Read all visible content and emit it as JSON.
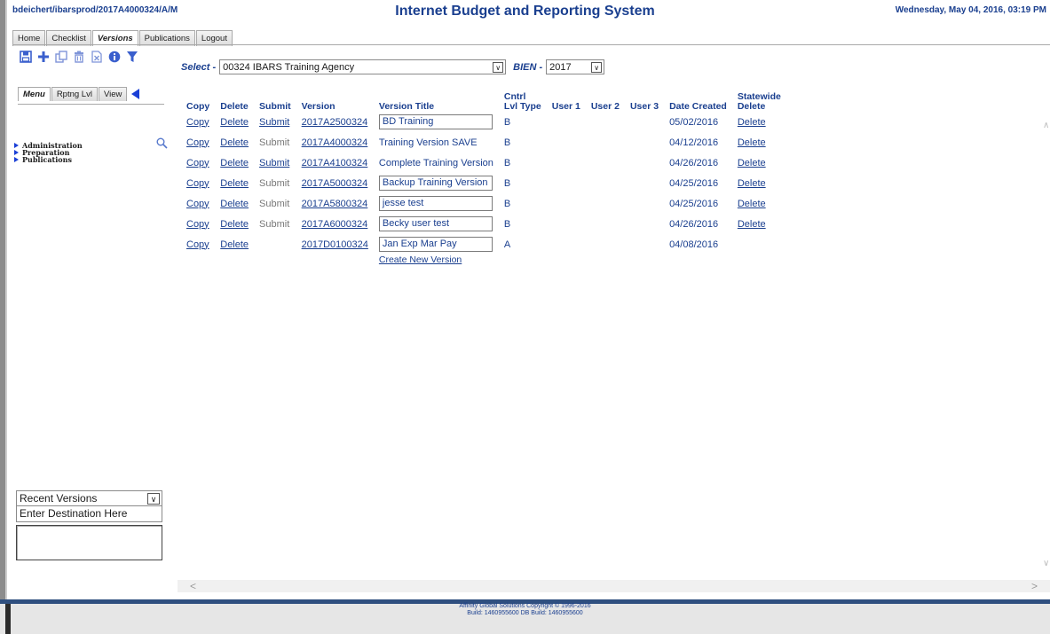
{
  "header": {
    "user_path": "bdeichert/ibarsprod/2017A4000324/A/M",
    "app_title": "Internet Budget and Reporting System",
    "datetime": "Wednesday, May 04, 2016, 03:19 PM"
  },
  "tabs": [
    {
      "label": "Home"
    },
    {
      "label": "Checklist"
    },
    {
      "label": "Versions",
      "active": true
    },
    {
      "label": "Publications"
    },
    {
      "label": "Logout"
    }
  ],
  "toolbar_icons": [
    "save-icon",
    "add-icon",
    "copy-icon",
    "delete-icon",
    "excel-icon",
    "info-icon",
    "filter-icon"
  ],
  "select_row": {
    "select_label": "Select -",
    "agency": "00324 IBARS Training Agency",
    "bien_label": "BIEN -",
    "bien": "2017"
  },
  "left_tabs": [
    {
      "label": "Menu",
      "active": true
    },
    {
      "label": "Rptng Lvl"
    },
    {
      "label": "View"
    }
  ],
  "menu": [
    "Administration",
    "Preparation",
    "Publications"
  ],
  "table": {
    "headers": {
      "copy": "Copy",
      "delete": "Delete",
      "submit": "Submit",
      "version": "Version",
      "title": "Version Title",
      "cntrl1": "Cntrl",
      "cntrl2": "Lvl Type",
      "user1": "User 1",
      "user2": "User 2",
      "user3": "User 3",
      "date": "Date Created",
      "sw1": "Statewide",
      "sw2": "Delete"
    },
    "rows": [
      {
        "copy": "Copy",
        "delete": "Delete",
        "submit": "Submit",
        "version": "2017A2500324",
        "title": "BD Training",
        "type": "B",
        "date": "05/02/2016",
        "sw_delete": "Delete"
      },
      {
        "copy": "Copy",
        "delete": "Delete",
        "submit": "Submit",
        "version": "2017A4000324",
        "title": "Training Version SAVE",
        "type": "B",
        "date": "04/12/2016",
        "sw_delete": "Delete"
      },
      {
        "copy": "Copy",
        "delete": "Delete",
        "submit": "Submit",
        "version": "2017A4100324",
        "title": "Complete Training Version",
        "type": "B",
        "date": "04/26/2016",
        "sw_delete": "Delete"
      },
      {
        "copy": "Copy",
        "delete": "Delete",
        "submit": "Submit",
        "version": "2017A5000324",
        "title": "Backup Training Version",
        "type": "B",
        "date": "04/25/2016",
        "sw_delete": "Delete"
      },
      {
        "copy": "Copy",
        "delete": "Delete",
        "submit": "Submit",
        "version": "2017A5800324",
        "title": "jesse test",
        "type": "B",
        "date": "04/25/2016",
        "sw_delete": "Delete"
      },
      {
        "copy": "Copy",
        "delete": "Delete",
        "submit": "Submit",
        "version": "2017A6000324",
        "title": "Becky user test",
        "type": "B",
        "date": "04/26/2016",
        "sw_delete": "Delete"
      },
      {
        "copy": "Copy",
        "delete": "Delete",
        "version": "2017D0100324",
        "title": "Jan Exp Mar Pay",
        "type": "A",
        "date": "04/08/2016"
      }
    ],
    "create_link": "Create New Version"
  },
  "recent": {
    "label": "Recent Versions",
    "destination": "Enter Destination Here"
  },
  "footer": {
    "copyright": "Affinity Global Solutions Copyright © 1996-2016",
    "build": "Build: 1460955600 DB Build: 1460955600"
  }
}
